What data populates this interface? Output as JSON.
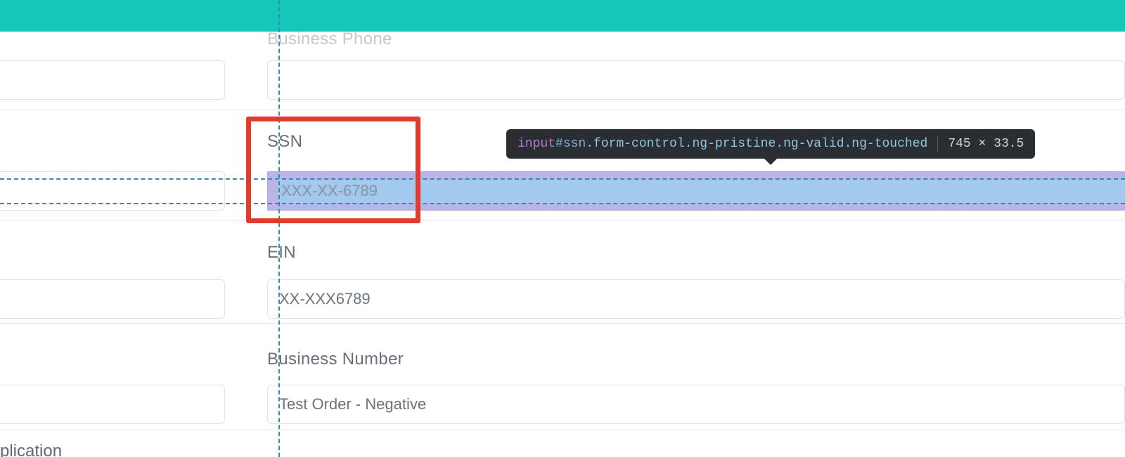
{
  "labels": {
    "business_phone": "Business Phone",
    "ssn": "SSN",
    "ein": "EIN",
    "business_number": "Business Number"
  },
  "values": {
    "business_phone": "",
    "ssn": "",
    "ein": "XX-XXX6789",
    "business_number": "Test Order - Negative"
  },
  "placeholders": {
    "ssn": "XXX-XX-6789"
  },
  "devtools": {
    "tag": "input",
    "id": "#ssn",
    "classes": ".form-control.ng-pristine.ng-valid.ng-touched",
    "dimensions": "745 × 33.5"
  },
  "bottom_cropped_text": "plication"
}
